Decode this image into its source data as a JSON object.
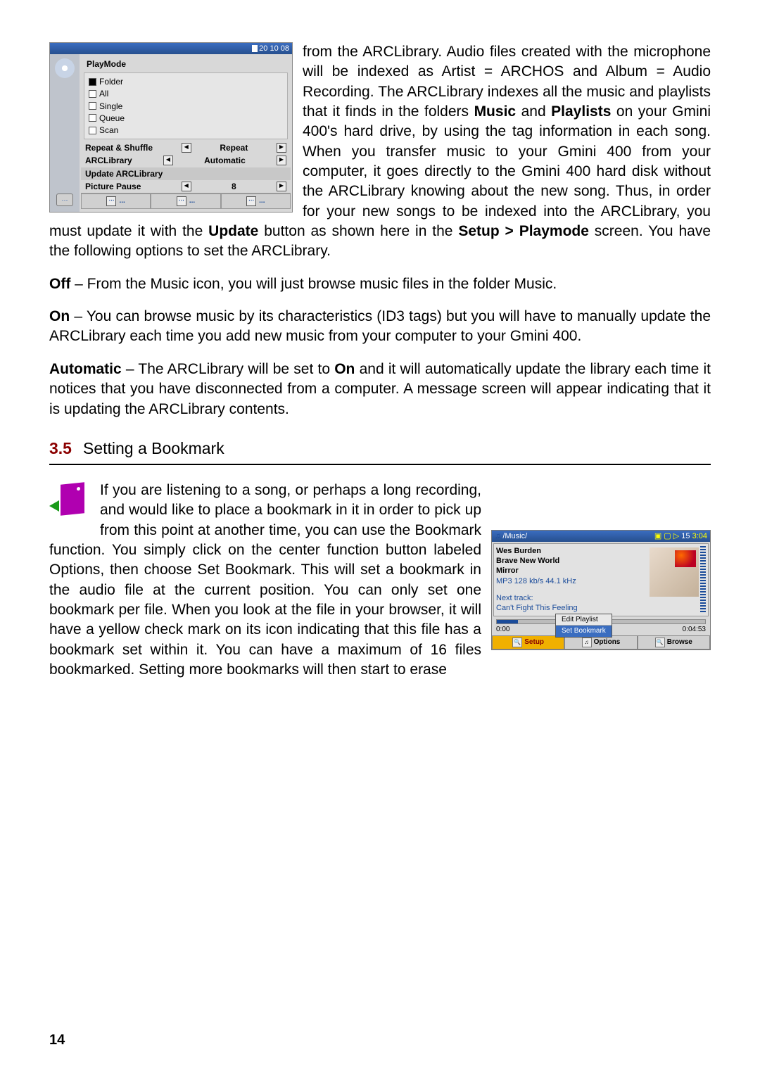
{
  "screenshot1": {
    "statusbar": "20    10 08",
    "title": "PlayMode",
    "options": [
      "Folder",
      "All",
      "Single",
      "Queue",
      "Scan"
    ],
    "rows": [
      {
        "label": "Repeat & Shuffle",
        "value": "Repeat"
      },
      {
        "label": "ARCLibrary",
        "value": "Automatic"
      },
      {
        "label": "Update ARCLibrary",
        "value": ""
      },
      {
        "label": "Picture Pause",
        "value": "8"
      }
    ],
    "softkeys": [
      "...",
      "...",
      "..."
    ]
  },
  "para1_a": "from the ARCLibrary. Audio files created with the microphone will be indexed as Artist = ARCHOS and Album = Audio Recording. The ARCLibrary indexes all the music and playlists that it finds in the folders ",
  "para1_b": " and ",
  "para1_c": " on your Gmini 400's hard drive, by using the tag information in each song. When you transfer music to your Gmini 400 from your computer, it goes directly to the Gmini 400 hard disk without the ARCLibrary knowing about the new song. Thus, in order for your new songs to be indexed into the ARCLibrary, you must update it with the ",
  "para1_d": " button as shown here in the ",
  "para1_e": " screen. You have the following options to set the ARCLibrary.",
  "bold_music": "Music",
  "bold_playlists": "Playlists",
  "bold_update": "Update",
  "bold_setup": "Setup > Playmode",
  "off_label": "Off",
  "off_text": " – From the Music icon, you will just browse music files in the folder Music.",
  "on_label": "On",
  "on_text": " – You can browse music by its characteristics (ID3 tags) but you will have to manually update the ARCLibrary each time you add new music from your computer to your Gmini 400.",
  "auto_label": "Automatic",
  "auto_text_a": " – The ARCLibrary will be set to ",
  "auto_text_b": " and it will automatically update the library each time it notices that you have disconnected from a computer. A message screen will appear indicating that it is updating the ARCLibrary contents.",
  "bold_on": "On",
  "section_num": "3.5",
  "section_title": "Setting a Bookmark",
  "para2_a": "If you are listening to a song, or perhaps a long recording, and would like to place a bookmark in it in order to pick up from this point at another time, you can use the Bookmark function. You simply click on the center function button labeled Options, then choose Set Bookmark. This will set a bookmark in the audio file at the current position. You can only set one bookmark per file. When you look at the file in your browser, it will have a yellow check mark on its icon indicating that this file has a bookmark set within it. You can have a maximum of 16 files bookmarked. Setting more bookmarks will then start to erase",
  "player": {
    "path": "/Music/",
    "status_right": "15",
    "clock": "3:04",
    "artist": "Wes Burden",
    "album": "Brave New World",
    "track": "Mirror",
    "format": "MP3 128 kb/s 44.1 kHz",
    "next_label": "Next track:",
    "next_track": "Can't Fight This Feeling",
    "t_cur": "0:00",
    "t_tot": "0:04:53",
    "menu1": "Edit Playlist",
    "menu2": "Set Bookmark",
    "soft1": "Setup",
    "soft2": "Options",
    "soft3": "Browse"
  },
  "page_num": "14"
}
